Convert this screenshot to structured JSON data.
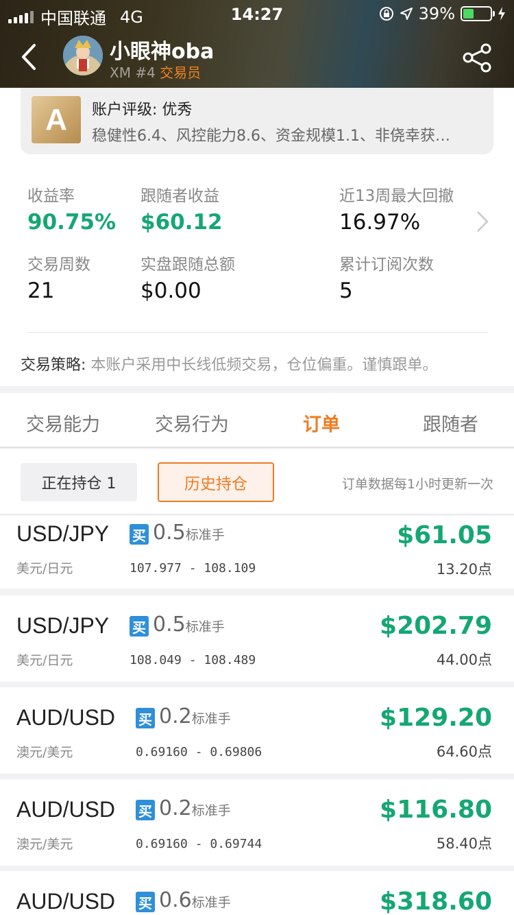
{
  "status_bar": {
    "carrier": "中国联通",
    "network": "4G",
    "time": "14:27",
    "battery": "39%"
  },
  "header": {
    "name": "小眼神oba",
    "broker": "XM #4",
    "role": "交易员"
  },
  "rating": {
    "grade": "A",
    "title": "账户评级: 优秀",
    "desc": "稳健性6.4、风控能力8.6、资金规模1.1、非侥幸获…"
  },
  "stats": {
    "return_label": "收益率",
    "return_value": "90.75%",
    "follower_profit_label": "跟随者收益",
    "follower_profit_value": "$60.12",
    "drawdown_label": "近13周最大回撤",
    "drawdown_value": "16.97%",
    "weeks_label": "交易周数",
    "weeks_value": "21",
    "live_total_label": "实盘跟随总额",
    "live_total_value": "$0.00",
    "subs_label": "累计订阅次数",
    "subs_value": "5"
  },
  "strategy": {
    "label": "交易策略:",
    "text": " 本账户采用中长线低频交易，仓位偏重。谨慎跟单。"
  },
  "tabs": [
    "交易能力",
    "交易行为",
    "订单",
    "跟随者"
  ],
  "subbar": {
    "open_label": "正在持仓 1",
    "history_label": "历史持仓",
    "note": "订单数据每1小时更新一次"
  },
  "orders": [
    {
      "pair": "USD/JPY",
      "side": "买",
      "lots": "0.5",
      "unit": "标准手",
      "cn": "美元/日元",
      "range": "107.977 - 108.109",
      "profit": "$61.05",
      "points": "13.20点"
    },
    {
      "pair": "USD/JPY",
      "side": "买",
      "lots": "0.5",
      "unit": "标准手",
      "cn": "美元/日元",
      "range": "108.049 - 108.489",
      "profit": "$202.79",
      "points": "44.00点"
    },
    {
      "pair": "AUD/USD",
      "side": "买",
      "lots": "0.2",
      "unit": "标准手",
      "cn": "澳元/美元",
      "range": "0.69160 - 0.69806",
      "profit": "$129.20",
      "points": "64.60点"
    },
    {
      "pair": "AUD/USD",
      "side": "买",
      "lots": "0.2",
      "unit": "标准手",
      "cn": "澳元/美元",
      "range": "0.69160 - 0.69744",
      "profit": "$116.80",
      "points": "58.40点"
    },
    {
      "pair": "AUD/USD",
      "side": "买",
      "lots": "0.6",
      "unit": "标准手",
      "cn": "",
      "range": "",
      "profit": "$318.60",
      "points": ""
    }
  ],
  "colors": {
    "accent": "#f07b22",
    "profit": "#15a772",
    "buy_badge": "#2f8fd8"
  }
}
